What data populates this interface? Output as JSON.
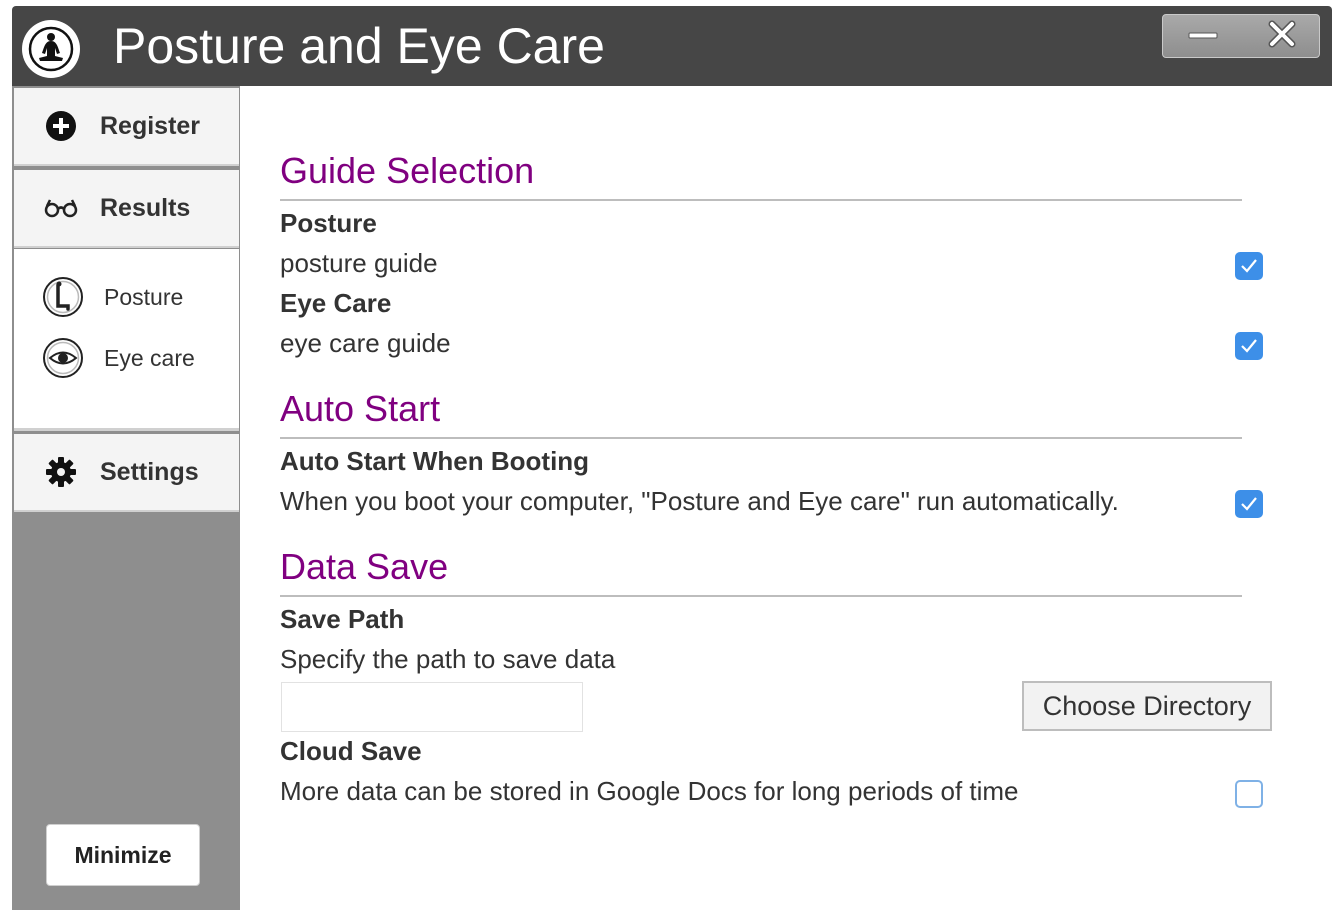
{
  "window": {
    "title": "Posture and Eye Care",
    "logo_icon": "meditation-icon",
    "controls": {
      "minimize_icon": "minimize-icon",
      "close_icon": "close-icon"
    }
  },
  "sidebar": {
    "register": {
      "label": "Register",
      "icon": "plus-circle-icon"
    },
    "results": {
      "label": "Results",
      "icon": "glasses-icon"
    },
    "sub_items": [
      {
        "label": "Posture",
        "icon": "posture-icon"
      },
      {
        "label": "Eye care",
        "icon": "eye-icon"
      }
    ],
    "settings": {
      "label": "Settings",
      "icon": "gear-icon"
    },
    "minimize_label": "Minimize"
  },
  "content": {
    "guide_selection": {
      "title": "Guide Selection",
      "posture": {
        "title": "Posture",
        "desc": "posture guide",
        "checked": true
      },
      "eye_care": {
        "title": "Eye Care",
        "desc": "eye care guide",
        "checked": true
      }
    },
    "auto_start": {
      "title": "Auto Start",
      "item_title": "Auto Start When Booting",
      "desc": "When you boot your computer, \"Posture and Eye care\" run automatically.",
      "checked": true
    },
    "data_save": {
      "title": "Data Save",
      "save_path_title": "Save Path",
      "save_path_desc": "Specify the path to save data",
      "path_value": "",
      "choose_label": "Choose Directory",
      "cloud_title": "Cloud Save",
      "cloud_desc": "More data can be stored in Google Docs for long periods of time",
      "cloud_checked": false
    }
  },
  "colors": {
    "titlebar": "#464646",
    "sidebar": "#8e8e8e",
    "section_title": "#800080",
    "checkbox": "#3d8fe8"
  }
}
